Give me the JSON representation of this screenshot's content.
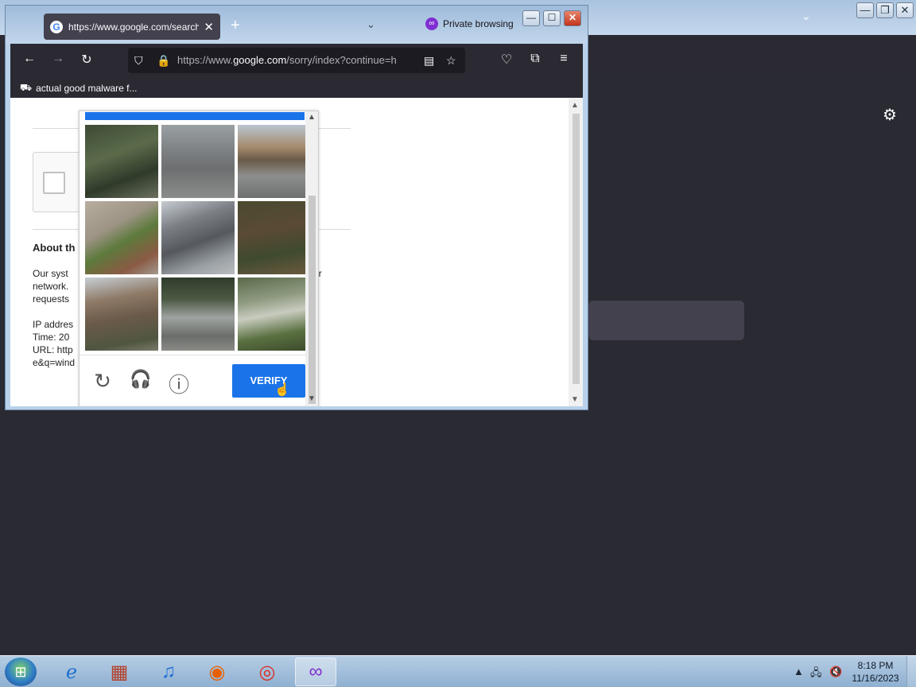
{
  "background_window": {
    "controls": [
      "—",
      "❐",
      "✕"
    ],
    "settings_icon": "gear-icon"
  },
  "browser": {
    "tab": {
      "favicon": "G",
      "title": "https://www.google.com/search?",
      "close": "✕"
    },
    "new_tab": "+",
    "private_label": "Private browsing",
    "window_controls": [
      "—",
      "☐",
      "✕"
    ],
    "nav": {
      "back": "←",
      "forward": "→",
      "reload": "↻"
    },
    "url": {
      "prefix": "https://www.",
      "domain": "google.com",
      "path": "/sorry/index?continue=h"
    },
    "bookmark": {
      "label": "actual good malware f..."
    }
  },
  "page": {
    "about_heading": "About th",
    "body_lines": [
      "Our syst",
      "network.",
      "requests"
    ],
    "right_fragments": [
      "er",
      "e"
    ],
    "info_lines": [
      "IP addres",
      "Time: 20",
      "URL: http",
      "e&q=wind"
    ]
  },
  "captcha": {
    "verify_label": "VERIFY",
    "reload_icon": "↻",
    "audio_icon": "🎧",
    "info_icon": "ⓘ",
    "tiles": [
      "trees",
      "road",
      "bridge",
      "crosswalk",
      "truss-bridge",
      "shrubs",
      "bridge",
      "street-sign",
      "trees"
    ]
  },
  "taskbar": {
    "apps": [
      "internet-explorer",
      "archive",
      "music",
      "firefox",
      "chrome",
      "firefox-private"
    ],
    "time": "8:18 PM",
    "date": "11/16/2023"
  }
}
